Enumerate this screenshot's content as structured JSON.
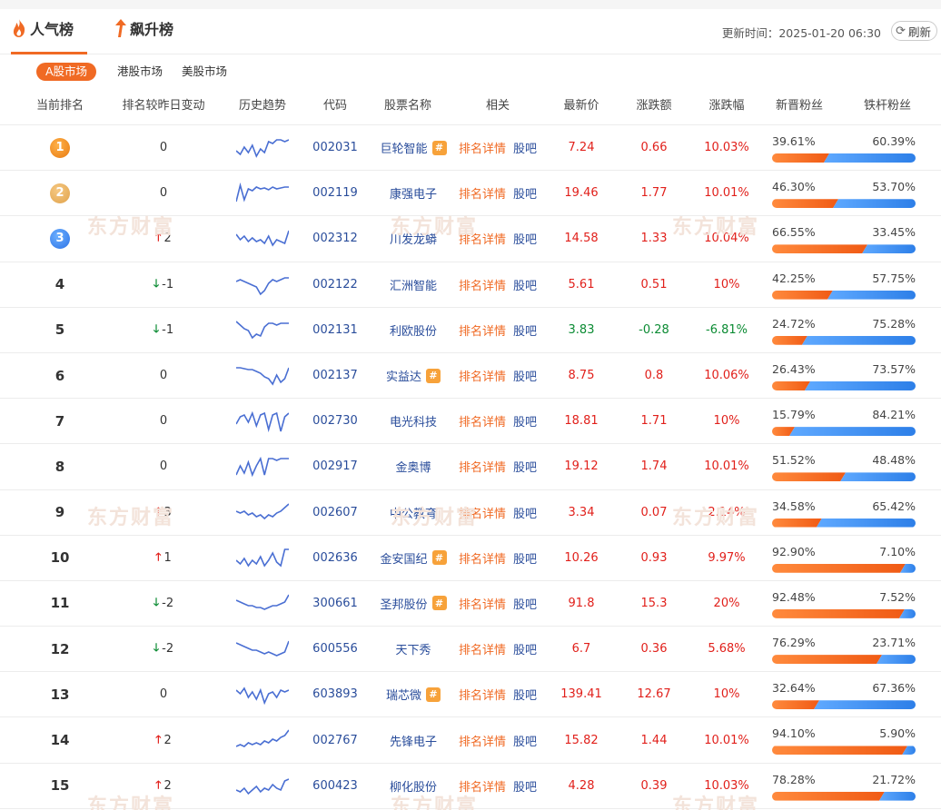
{
  "tabs": [
    {
      "label": "人气榜",
      "active": true
    },
    {
      "label": "飙升榜",
      "active": false
    }
  ],
  "updated": "更新时间：2025-01-20 06:30",
  "refresh_label": "刷新",
  "markets": [
    {
      "label": "A股市场",
      "active": true
    },
    {
      "label": "港股市场",
      "active": false
    },
    {
      "label": "美股市场",
      "active": false
    }
  ],
  "columns": [
    "当前排名",
    "排名较昨日变动",
    "历史趋势",
    "代码",
    "股票名称",
    "相关",
    "最新价",
    "涨跌额",
    "涨跌幅",
    "新晋粉丝",
    "铁杆粉丝"
  ],
  "related_links": {
    "detail": "排名详情",
    "forum": "股吧"
  },
  "watermark_text": "东方财富",
  "colors": {
    "accent": "#f06a24",
    "up": "#e1201b",
    "down": "#0b8b33",
    "link": "#2a4d9b",
    "spark": "#4a6fd3"
  },
  "rows": [
    {
      "rank": "1",
      "medal": "gold",
      "change": "0",
      "dir": "none",
      "code": "002031",
      "name": "巨轮智能",
      "hot": true,
      "price": "7.24",
      "amt": "0.66",
      "pct": "10.03%",
      "color": "red",
      "new_fans": "39.61%",
      "iron_fans": "60.39%",
      "new_frac": 0.3961,
      "spark": [
        18,
        22,
        14,
        20,
        12,
        24,
        16,
        20,
        8,
        10,
        6,
        6,
        8,
        6
      ]
    },
    {
      "rank": "2",
      "medal": "silver",
      "change": "0",
      "dir": "none",
      "code": "002119",
      "name": "康强电子",
      "hot": false,
      "price": "19.46",
      "amt": "1.77",
      "pct": "10.01%",
      "color": "red",
      "new_fans": "46.30%",
      "iron_fans": "53.70%",
      "new_frac": 0.463,
      "spark": [
        24,
        6,
        22,
        10,
        12,
        8,
        10,
        9,
        11,
        8,
        10,
        9,
        8,
        8
      ]
    },
    {
      "rank": "3",
      "medal": "blue",
      "change": "2",
      "dir": "up",
      "code": "002312",
      "name": "川发龙蟒",
      "hot": false,
      "price": "14.58",
      "amt": "1.33",
      "pct": "10.04%",
      "color": "red",
      "new_fans": "66.55%",
      "iron_fans": "33.45%",
      "new_frac": 0.6655,
      "spark": [
        10,
        16,
        12,
        18,
        14,
        18,
        16,
        20,
        12,
        22,
        16,
        18,
        20,
        6
      ]
    },
    {
      "rank": "4",
      "medal": "",
      "change": "-1",
      "dir": "down",
      "code": "002122",
      "name": "汇洲智能",
      "hot": false,
      "price": "5.61",
      "amt": "0.51",
      "pct": "10%",
      "color": "red",
      "new_fans": "42.25%",
      "iron_fans": "57.75%",
      "new_frac": 0.4225,
      "spark": [
        12,
        10,
        12,
        14,
        16,
        18,
        26,
        22,
        14,
        10,
        12,
        10,
        8,
        8
      ]
    },
    {
      "rank": "5",
      "medal": "",
      "change": "-1",
      "dir": "down",
      "code": "002131",
      "name": "利欧股份",
      "hot": false,
      "price": "3.83",
      "amt": "-0.28",
      "pct": "-6.81%",
      "color": "green",
      "new_fans": "24.72%",
      "iron_fans": "75.28%",
      "new_frac": 0.2472,
      "spark": [
        6,
        10,
        14,
        16,
        24,
        20,
        22,
        12,
        8,
        8,
        10,
        8,
        8,
        8
      ]
    },
    {
      "rank": "6",
      "medal": "",
      "change": "0",
      "dir": "none",
      "code": "002137",
      "name": "实益达",
      "hot": true,
      "price": "8.75",
      "amt": "0.8",
      "pct": "10.06%",
      "color": "red",
      "new_fans": "26.43%",
      "iron_fans": "73.57%",
      "new_frac": 0.2643,
      "spark": [
        6,
        6,
        7,
        8,
        8,
        10,
        12,
        16,
        18,
        24,
        14,
        22,
        18,
        6
      ]
    },
    {
      "rank": "7",
      "medal": "",
      "change": "0",
      "dir": "none",
      "code": "002730",
      "name": "电光科技",
      "hot": false,
      "price": "18.81",
      "amt": "1.71",
      "pct": "10%",
      "color": "red",
      "new_fans": "15.79%",
      "iron_fans": "84.21%",
      "new_frac": 0.1579,
      "spark": [
        18,
        10,
        8,
        16,
        6,
        20,
        8,
        6,
        24,
        8,
        6,
        26,
        10,
        6
      ]
    },
    {
      "rank": "8",
      "medal": "",
      "change": "0",
      "dir": "none",
      "code": "002917",
      "name": "金奥博",
      "hot": false,
      "price": "19.12",
      "amt": "1.74",
      "pct": "10.01%",
      "color": "red",
      "new_fans": "51.52%",
      "iron_fans": "48.48%",
      "new_frac": 0.5152,
      "spark": [
        24,
        14,
        22,
        10,
        24,
        14,
        6,
        24,
        6,
        6,
        8,
        6,
        6,
        6
      ]
    },
    {
      "rank": "9",
      "medal": "",
      "change": "3",
      "dir": "up",
      "code": "002607",
      "name": "中公教育",
      "hot": false,
      "price": "3.34",
      "amt": "0.07",
      "pct": "2.14%",
      "color": "red",
      "new_fans": "34.58%",
      "iron_fans": "65.42%",
      "new_frac": 0.3458,
      "spark": [
        14,
        16,
        14,
        18,
        16,
        20,
        18,
        22,
        18,
        20,
        16,
        14,
        10,
        6
      ]
    },
    {
      "rank": "10",
      "medal": "",
      "change": "1",
      "dir": "up",
      "code": "002636",
      "name": "金安国纪",
      "hot": true,
      "price": "10.26",
      "amt": "0.93",
      "pct": "9.97%",
      "color": "red",
      "new_fans": "92.90%",
      "iron_fans": "7.10%",
      "new_frac": 0.929,
      "spark": [
        18,
        22,
        16,
        24,
        18,
        22,
        14,
        24,
        18,
        10,
        20,
        24,
        6,
        6
      ]
    },
    {
      "rank": "11",
      "medal": "",
      "change": "-2",
      "dir": "down",
      "code": "300661",
      "name": "圣邦股份",
      "hot": true,
      "price": "91.8",
      "amt": "15.3",
      "pct": "20%",
      "color": "red",
      "new_fans": "92.48%",
      "iron_fans": "7.52%",
      "new_frac": 0.9248,
      "spark": [
        12,
        14,
        16,
        18,
        18,
        20,
        20,
        22,
        20,
        18,
        18,
        16,
        14,
        6
      ]
    },
    {
      "rank": "12",
      "medal": "",
      "change": "-2",
      "dir": "down",
      "code": "600556",
      "name": "天下秀",
      "hot": false,
      "price": "6.7",
      "amt": "0.36",
      "pct": "5.68%",
      "color": "red",
      "new_fans": "76.29%",
      "iron_fans": "23.71%",
      "new_frac": 0.7629,
      "spark": [
        8,
        10,
        12,
        14,
        16,
        16,
        18,
        20,
        18,
        20,
        22,
        20,
        18,
        6
      ]
    },
    {
      "rank": "13",
      "medal": "",
      "change": "0",
      "dir": "none",
      "code": "603893",
      "name": "瑞芯微",
      "hot": true,
      "price": "139.41",
      "amt": "12.67",
      "pct": "10%",
      "color": "red",
      "new_fans": "32.64%",
      "iron_fans": "67.36%",
      "new_frac": 0.3264,
      "spark": [
        10,
        14,
        8,
        18,
        12,
        20,
        10,
        24,
        14,
        12,
        18,
        10,
        12,
        10
      ]
    },
    {
      "rank": "14",
      "medal": "",
      "change": "2",
      "dir": "up",
      "code": "002767",
      "name": "先锋电子",
      "hot": false,
      "price": "15.82",
      "amt": "1.44",
      "pct": "10.01%",
      "color": "red",
      "new_fans": "94.10%",
      "iron_fans": "5.90%",
      "new_frac": 0.941,
      "spark": [
        22,
        20,
        22,
        18,
        20,
        18,
        20,
        16,
        18,
        14,
        16,
        12,
        10,
        4
      ]
    },
    {
      "rank": "15",
      "medal": "",
      "change": "2",
      "dir": "up",
      "code": "600423",
      "name": "柳化股份",
      "hot": false,
      "price": "4.28",
      "amt": "0.39",
      "pct": "10.03%",
      "color": "red",
      "new_fans": "78.28%",
      "iron_fans": "21.72%",
      "new_frac": 0.7828,
      "spark": [
        20,
        22,
        18,
        24,
        20,
        16,
        22,
        18,
        20,
        14,
        18,
        20,
        10,
        8
      ]
    }
  ]
}
